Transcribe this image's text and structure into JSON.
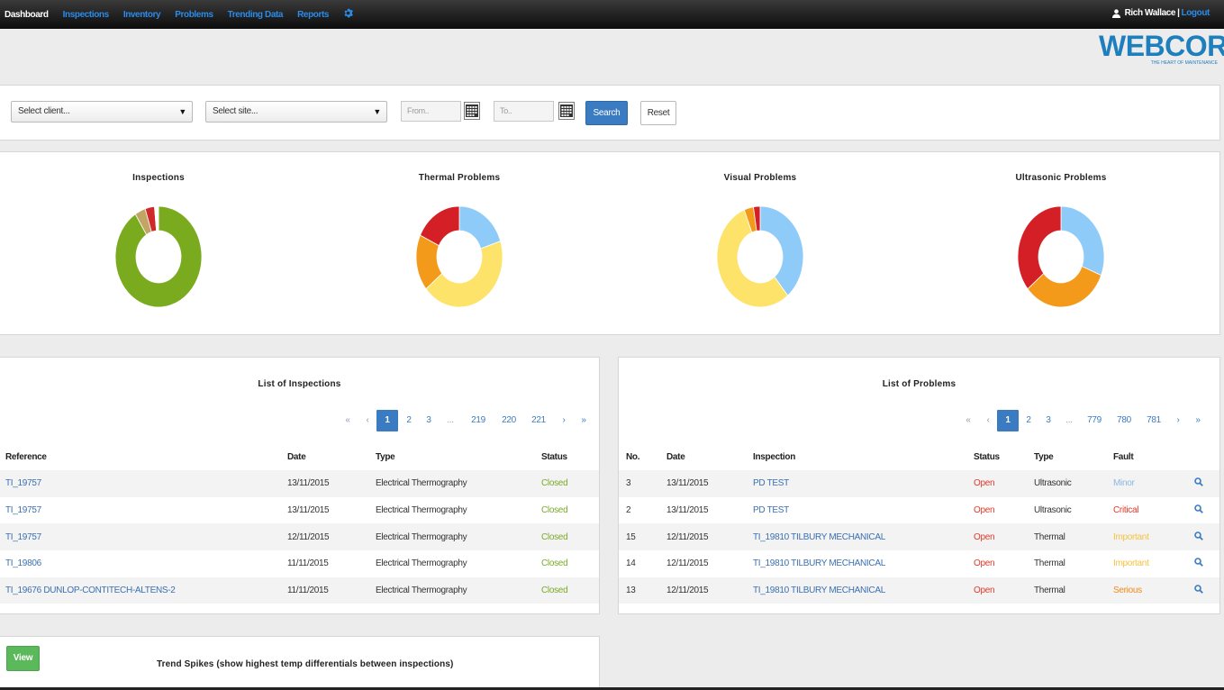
{
  "nav": {
    "items": [
      {
        "label": "Dashboard",
        "active": true
      },
      {
        "label": "Inspections"
      },
      {
        "label": "Inventory"
      },
      {
        "label": "Problems"
      },
      {
        "label": "Trending Data"
      },
      {
        "label": "Reports"
      }
    ],
    "settings_icon": "gear-icon",
    "user_icon": "user-icon",
    "user_name": "Rich Wallace",
    "separator": "|",
    "logout_label": "Logout"
  },
  "logo": {
    "text": "WEBCOR",
    "tagline": "THE HEART OF MAINTENANCE",
    "color": "#1e7fbf"
  },
  "filters": {
    "client_placeholder": "Select client...",
    "site_placeholder": "Select site...",
    "from_placeholder": "From..",
    "to_placeholder": "To..",
    "calendar_icon": "calendar-icon",
    "dropdown_arrow": "▼",
    "search_label": "Search",
    "reset_label": "Reset"
  },
  "charts": {
    "inspections_title": "Inspections",
    "thermal_title": "Thermal Problems",
    "visual_title": "Visual Problems",
    "ultrasonic_title": "Ultrasonic Problems"
  },
  "chart_data": [
    {
      "type": "pie",
      "title": "Inspections",
      "donut": true,
      "slices": [
        {
          "value": 91,
          "color": "#7aab1f"
        },
        {
          "value": 4,
          "color": "#c2a464"
        },
        {
          "value": 3.5,
          "color": "#cf2929"
        },
        {
          "value": 1.5,
          "color": "#ffffff"
        }
      ]
    },
    {
      "type": "pie",
      "title": "Thermal Problems",
      "donut": true,
      "slices": [
        {
          "value": 20,
          "color": "#8ecbf8"
        },
        {
          "value": 44,
          "color": "#fde36a"
        },
        {
          "value": 18,
          "color": "#f49a1b"
        },
        {
          "value": 18,
          "color": "#d51f26"
        }
      ]
    },
    {
      "type": "pie",
      "title": "Visual Problems",
      "donut": true,
      "slices": [
        {
          "value": 39,
          "color": "#8ecbf8"
        },
        {
          "value": 55,
          "color": "#fde36a"
        },
        {
          "value": 3.5,
          "color": "#f49a1b"
        },
        {
          "value": 2.5,
          "color": "#d51f26"
        }
      ]
    },
    {
      "type": "pie",
      "title": "Ultrasonic Problems",
      "donut": true,
      "slices": [
        {
          "value": 31,
          "color": "#8ecbf8"
        },
        {
          "value": 33,
          "color": "#f49a1b"
        },
        {
          "value": 36,
          "color": "#d51f26"
        }
      ]
    }
  ],
  "inspections": {
    "title": "List of Inspections",
    "pager": [
      "«",
      "‹",
      "1",
      "2",
      "3",
      "...",
      "219",
      "220",
      "221",
      "›",
      "»"
    ],
    "headers": [
      "Reference",
      "Date",
      "Type",
      "Status"
    ],
    "rows": [
      {
        "ref": "TI_19757",
        "date": "13/11/2015",
        "type": "Electrical Thermography",
        "status": "Closed"
      },
      {
        "ref": "TI_19757",
        "date": "13/11/2015",
        "type": "Electrical Thermography",
        "status": "Closed"
      },
      {
        "ref": "TI_19757",
        "date": "12/11/2015",
        "type": "Electrical Thermography",
        "status": "Closed"
      },
      {
        "ref": "TI_19806",
        "date": "11/11/2015",
        "type": "Electrical Thermography",
        "status": "Closed"
      },
      {
        "ref": "TI_19676 DUNLOP-CONTITECH-ALTENS-2",
        "date": "11/11/2015",
        "type": "Electrical Thermography",
        "status": "Closed"
      }
    ]
  },
  "problems": {
    "title": "List of Problems",
    "pager": [
      "«",
      "‹",
      "1",
      "2",
      "3",
      "...",
      "779",
      "780",
      "781",
      "›",
      "»"
    ],
    "headers": [
      "No.",
      "Date",
      "Inspection",
      "Status",
      "Type",
      "Fault"
    ],
    "view_icon": "magnifier-icon",
    "rows": [
      {
        "no": "3",
        "date": "13/11/2015",
        "inspection": "PD TEST",
        "status": "Open",
        "type": "Ultrasonic",
        "fault": "Minor"
      },
      {
        "no": "2",
        "date": "13/11/2015",
        "inspection": "PD TEST",
        "status": "Open",
        "type": "Ultrasonic",
        "fault": "Critical"
      },
      {
        "no": "15",
        "date": "12/11/2015",
        "inspection": "TI_19810 TILBURY MECHANICAL",
        "status": "Open",
        "type": "Thermal",
        "fault": "Important"
      },
      {
        "no": "14",
        "date": "12/11/2015",
        "inspection": "TI_19810 TILBURY MECHANICAL",
        "status": "Open",
        "type": "Thermal",
        "fault": "Important"
      },
      {
        "no": "13",
        "date": "12/11/2015",
        "inspection": "TI_19810 TILBURY MECHANICAL",
        "status": "Open",
        "type": "Thermal",
        "fault": "Serious"
      }
    ]
  },
  "trend": {
    "view_label": "View",
    "text": "Trend Spikes (show highest temp differentials between inspections)"
  },
  "colors": {
    "nav_link": "#2a8be8",
    "primary": "#3b7bc2",
    "success": "#5bb85b",
    "closed": "#7aaa2a",
    "open": "#e03a2a"
  }
}
